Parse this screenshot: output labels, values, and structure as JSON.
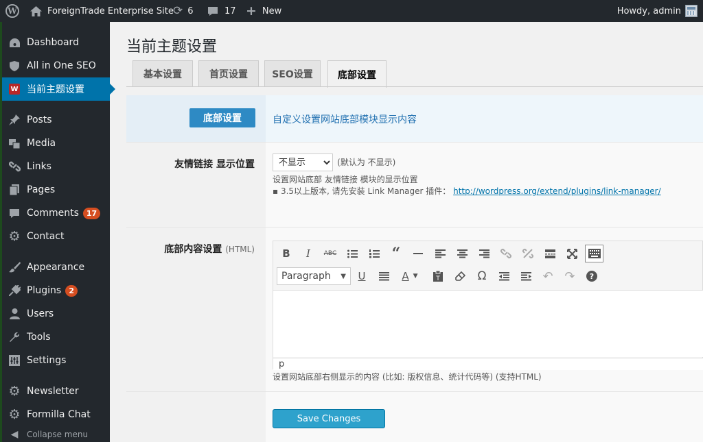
{
  "adminbar": {
    "site_name": "ForeignTrade Enterprise Site",
    "updates_count": "6",
    "comments_count": "17",
    "new_label": "New",
    "howdy": "Howdy, admin"
  },
  "sidebar": {
    "items": [
      {
        "label": "Dashboard",
        "icon": "dashboard-icon"
      },
      {
        "label": "All in One SEO",
        "icon": "shield-icon"
      },
      {
        "label": "当前主题设置",
        "icon": "w-logo-icon"
      },
      {
        "label": "Posts",
        "icon": "pin-icon"
      },
      {
        "label": "Media",
        "icon": "media-icon"
      },
      {
        "label": "Links",
        "icon": "link-icon"
      },
      {
        "label": "Pages",
        "icon": "pages-icon"
      },
      {
        "label": "Comments",
        "icon": "comment-icon",
        "badge": "17"
      },
      {
        "label": "Contact",
        "icon": "gear-icon"
      },
      {
        "label": "Appearance",
        "icon": "brush-icon"
      },
      {
        "label": "Plugins",
        "icon": "plug-icon",
        "badge": "2"
      },
      {
        "label": "Users",
        "icon": "user-icon"
      },
      {
        "label": "Tools",
        "icon": "wrench-icon"
      },
      {
        "label": "Settings",
        "icon": "settings-icon"
      },
      {
        "label": "Newsletter",
        "icon": "gear-icon"
      },
      {
        "label": "Formilla Chat",
        "icon": "gear-icon"
      },
      {
        "label": "Collapse menu",
        "icon": "collapse-icon"
      }
    ]
  },
  "page": {
    "title": "当前主题设置",
    "tabs": [
      "基本设置",
      "首页设置",
      "SEO设置",
      "底部设置"
    ]
  },
  "section": {
    "button": "底部设置",
    "description": "自定义设置网站底部模块显示内容"
  },
  "friend_links": {
    "label": "友情链接 显示位置",
    "selected": "不显示",
    "default_note": "(默认为 不显示)",
    "hint1": "设置网站底部 友情链接 模块的显示位置",
    "hint2": "▪ 3.5以上版本, 请先安装 Link Manager 插件：",
    "link": "http://wordpress.org/extend/plugins/link-manager/"
  },
  "footer_content": {
    "label": "底部内容设置",
    "label_sub": "(HTML)",
    "format_select": "Paragraph",
    "path": "p",
    "hint": "设置网站底部右侧显示的内容 (比如: 版权信息、统计代码等) (支持HTML)"
  },
  "save_label": "Save Changes",
  "colors": {
    "adminbar_bg": "#23282d",
    "accent": "#0073aa",
    "badge": "#d54e21",
    "button": "#2ea2cc"
  }
}
